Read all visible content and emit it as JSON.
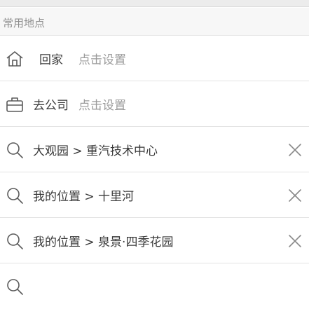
{
  "section": {
    "title": "常用地点"
  },
  "places": [
    {
      "label": "回家",
      "hint": "点击设置",
      "icon": "home-icon"
    },
    {
      "label": "去公司",
      "hint": "点击设置",
      "icon": "briefcase-icon"
    }
  ],
  "history": [
    {
      "text": "大观园 > 重汽技术中心",
      "icon": "search-icon",
      "action_icon": "close-icon"
    },
    {
      "text": "我的位置 > 十里河",
      "icon": "search-icon",
      "action_icon": "close-icon"
    },
    {
      "text": "我的位置 > 泉景·四季花园",
      "icon": "search-icon",
      "action_icon": "close-icon"
    }
  ],
  "colors": {
    "icon_stroke": "#5a5a5a",
    "close_stroke": "#8a8a8a",
    "hint": "#9a9a9a",
    "divider": "#e3e3e3"
  }
}
